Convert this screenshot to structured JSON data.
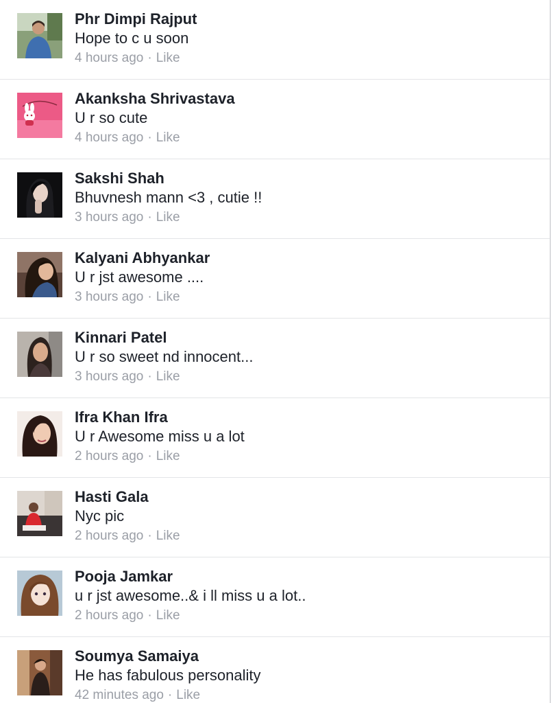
{
  "comments": [
    {
      "author": "Phr Dimpi Rajput",
      "text": "Hope to c u soon",
      "time": "4 hours ago",
      "separator": "·",
      "like_label": "Like"
    },
    {
      "author": "Akanksha Shrivastava",
      "text": "U r so cute",
      "time": "4 hours ago",
      "separator": "·",
      "like_label": "Like"
    },
    {
      "author": "Sakshi Shah",
      "text": "Bhuvnesh mann <3 , cutie !!",
      "time": "3 hours ago",
      "separator": "·",
      "like_label": "Like"
    },
    {
      "author": "Kalyani Abhyankar",
      "text": "U r jst awesome ....",
      "time": "3 hours ago",
      "separator": "·",
      "like_label": "Like"
    },
    {
      "author": "Kinnari Patel",
      "text": "U r so sweet nd innocent...",
      "time": "3 hours ago",
      "separator": "·",
      "like_label": "Like"
    },
    {
      "author": "Ifra Khan Ifra",
      "text": "U r Awesome miss u a lot",
      "time": "2 hours ago",
      "separator": "·",
      "like_label": "Like"
    },
    {
      "author": "Hasti Gala",
      "text": "Nyc pic",
      "time": "2 hours ago",
      "separator": "·",
      "like_label": "Like"
    },
    {
      "author": "Pooja Jamkar",
      "text": "u r jst awesome..& i ll miss u a lot..",
      "time": "2 hours ago",
      "separator": "·",
      "like_label": "Like"
    },
    {
      "author": "Soumya Samaiya",
      "text": "He has fabulous personality",
      "time": "42 minutes ago",
      "separator": "·",
      "like_label": "Like"
    }
  ],
  "colors": {
    "name_text": "#1d2129",
    "meta_text": "#9a9ea6",
    "divider": "#e3e4e7"
  }
}
